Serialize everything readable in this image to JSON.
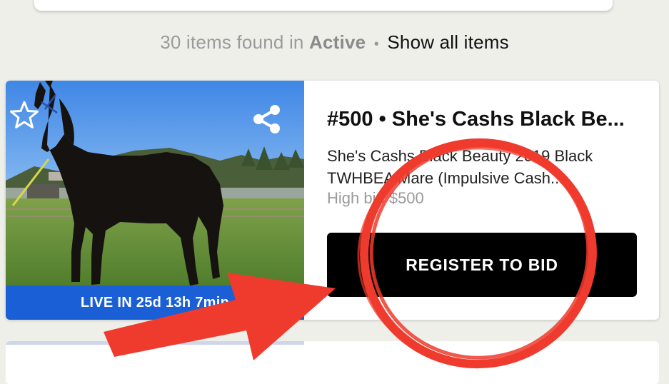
{
  "results": {
    "count_text": "30 items found in",
    "filter": "Active",
    "separator": "•",
    "show_all_link": "Show all items"
  },
  "item": {
    "title": "#500 • She's Cashs Black Be...",
    "description": "She's Cashs Black Beauty 2019 Black TWHBEA Mare (Impulsive Cash...",
    "bid_text": "High bid $500",
    "live_banner": "LIVE IN 25d 13h 7min",
    "register_button": "REGISTER TO BID",
    "icons": {
      "favorite": "star-outline-icon",
      "share": "share-icon"
    }
  },
  "colors": {
    "banner": "#1a5fd6",
    "button": "#000000",
    "annotation": "#ef3b2d"
  }
}
